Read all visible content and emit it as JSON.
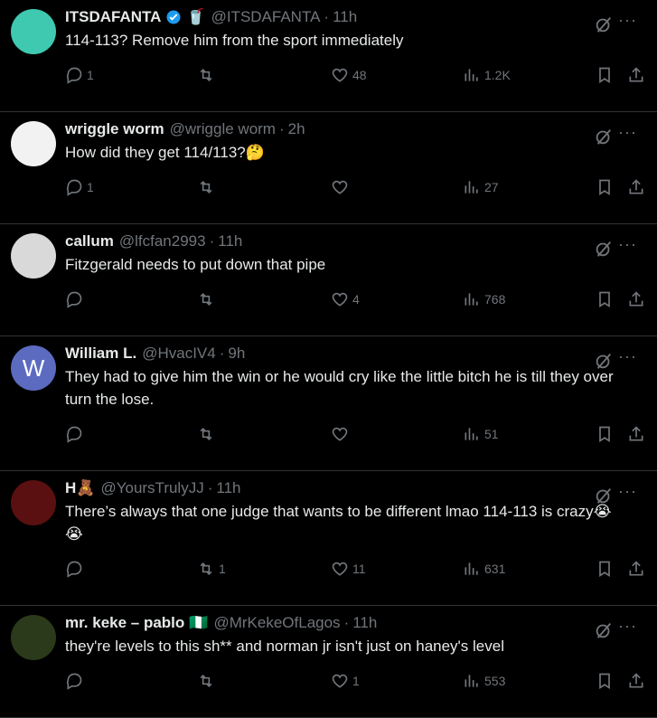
{
  "tweets": [
    {
      "name": "ITSDAFANTA",
      "badge_emoji": "🥤",
      "verified": true,
      "handle": "@ITSDAFANTA",
      "time": "11h",
      "text": "114-113? Remove him from the sport immediately",
      "replies": "1",
      "reposts": "",
      "likes": "48",
      "views": "1.2K",
      "avatar_color": "#3ec9b0"
    },
    {
      "name": "wriggle worm",
      "handle": "@wriggle worm",
      "time": "2h",
      "text": "How did they get 114/113?🤔",
      "replies": "1",
      "reposts": "",
      "likes": "",
      "views": "27",
      "avatar_color": "#f2f2f2"
    },
    {
      "name": "callum",
      "handle": "@lfcfan2993",
      "time": "11h",
      "text": "Fitzgerald needs to put down that pipe",
      "replies": "",
      "reposts": "",
      "likes": "4",
      "views": "768",
      "avatar_color": "#d9d9d9"
    },
    {
      "name": "William L.",
      "handle": "@HvacIV4",
      "time": "9h",
      "text": "They had to give him the win or he would cry like the little bitch he is till they over turn the lose.",
      "replies": "",
      "reposts": "",
      "likes": "",
      "views": "51",
      "avatar_letter": "W",
      "avatar_color": "#5c6bc0"
    },
    {
      "name": "H🧸",
      "handle": "@YoursTrulyJJ",
      "time": "11h",
      "text": "There’s always that one judge that wants to be different lmao 114-113 is crazy😭😭",
      "replies": "",
      "reposts": "1",
      "likes": "11",
      "views": "631",
      "avatar_color": "#5a1010"
    },
    {
      "name": "mr. keke – pablo",
      "badge_emoji": "🇳🇬",
      "handle": "@MrKekeOfLagos",
      "time": "11h",
      "text": "they're levels to this sh** and norman jr isn't just on haney's level",
      "replies": "",
      "reposts": "",
      "likes": "1",
      "views": "553",
      "avatar_color": "#2a3a1a"
    }
  ],
  "colors": {
    "background": "#000000",
    "text": "#e7e9ea",
    "muted": "#71767b",
    "border": "#2f3336",
    "verified": "#1d9bf0"
  },
  "icons": [
    "reply-icon",
    "repost-icon",
    "like-icon",
    "views-icon",
    "bookmark-icon",
    "share-icon",
    "grok-icon",
    "more-icon",
    "verified-icon"
  ]
}
